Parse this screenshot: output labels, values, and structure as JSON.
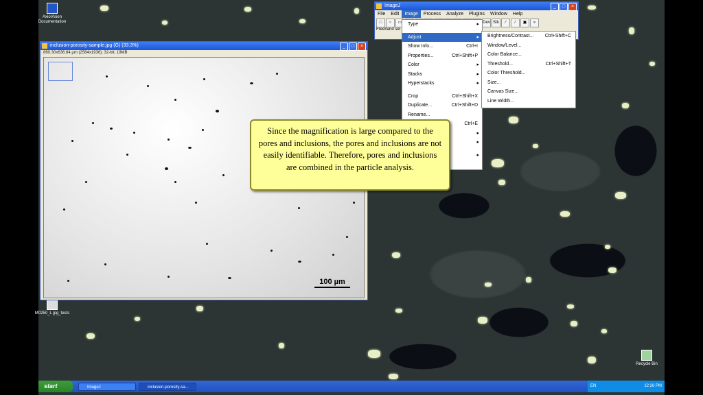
{
  "desktop": {
    "icons": [
      {
        "label": "AxioVision Documentation"
      },
      {
        "label": "M0250_L jpg_tests"
      },
      {
        "label": "Recycle Bin"
      }
    ]
  },
  "image_window": {
    "title": "inclusion-porosity-sample.jpg (G) (33.3%)",
    "info": "860.30x636.84 µm (2584x1936); 32-bit; 19MB",
    "scale_label": "100 µm"
  },
  "imagej": {
    "title": "ImageJ",
    "menus": [
      "File",
      "Edit",
      "Image",
      "Process",
      "Analyze",
      "Plugins",
      "Window",
      "Help"
    ],
    "selected_menu": "Image",
    "status": "Freehand sel",
    "tools": [
      "□",
      "○",
      "▭",
      "◇",
      "／",
      "∠",
      "✛",
      "↔",
      "A",
      "🔍",
      "✋",
      "Dev",
      "Stk",
      "⁄",
      "⁄",
      "▣",
      "»"
    ]
  },
  "image_menu": {
    "items": [
      {
        "label": "Type",
        "shortcut": "",
        "submenu": true
      },
      {
        "label": "Adjust",
        "shortcut": "",
        "submenu": true,
        "highlight": true
      },
      {
        "label": "Show Info...",
        "shortcut": "Ctrl+I"
      },
      {
        "label": "Properties...",
        "shortcut": "Ctrl+Shift+P"
      },
      {
        "label": "Color",
        "shortcut": "",
        "submenu": true
      },
      {
        "label": "Stacks",
        "shortcut": "",
        "submenu": true
      },
      {
        "label": "Hyperstacks",
        "shortcut": "",
        "submenu": true
      },
      {
        "label": "Crop",
        "shortcut": "Ctrl+Shift+X"
      },
      {
        "label": "Duplicate...",
        "shortcut": "Ctrl+Shift+D"
      },
      {
        "label": "Rename...",
        "shortcut": ""
      },
      {
        "label": "",
        "shortcut": "Ctrl+E"
      }
    ]
  },
  "adjust_menu": {
    "items": [
      {
        "label": "Brightness/Contrast...",
        "shortcut": "Ctrl+Shift+C"
      },
      {
        "label": "Window/Level...",
        "shortcut": ""
      },
      {
        "label": "Color Balance...",
        "shortcut": ""
      },
      {
        "label": "Threshold...",
        "shortcut": "Ctrl+Shift+T"
      },
      {
        "label": "Color Threshold...",
        "shortcut": ""
      },
      {
        "label": "Size...",
        "shortcut": ""
      },
      {
        "label": "Canvas Size...",
        "shortcut": ""
      },
      {
        "label": "Line Width...",
        "shortcut": ""
      }
    ]
  },
  "callout": {
    "text": "Since the magnification is large compared to the pores and inclusions, the pores and inclusions are not easily identifiable. Therefore, pores and inclusions are combined in the particle analysis."
  },
  "taskbar": {
    "start": "start",
    "items": [
      "ImageJ",
      "inclusion-porosity-sa..."
    ],
    "lang": "EN",
    "time": "12:26 PM"
  }
}
